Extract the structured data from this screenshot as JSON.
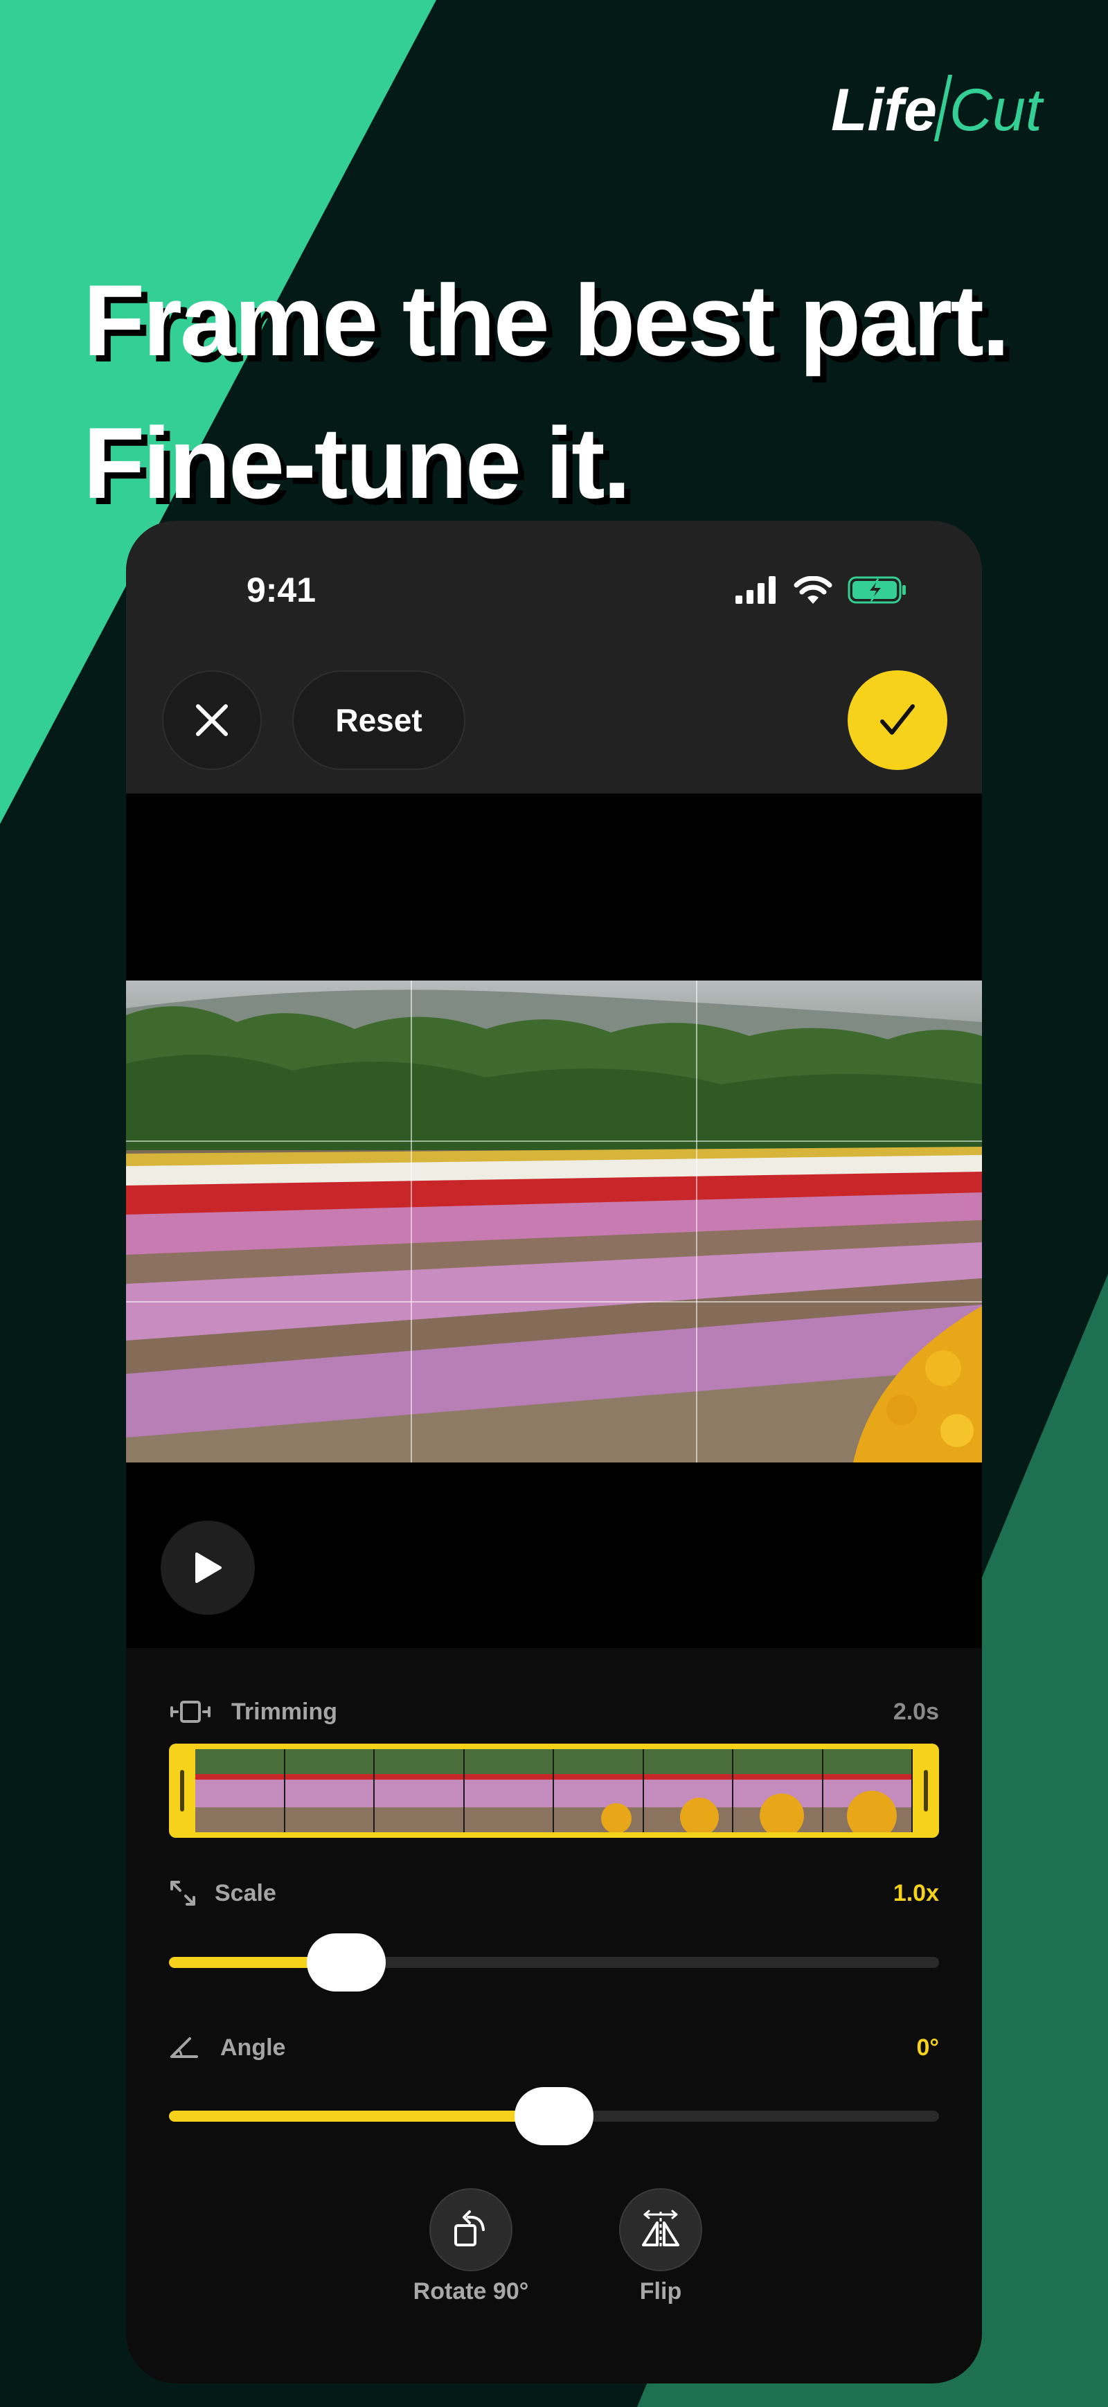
{
  "brand": {
    "logo_left": "Life",
    "logo_right": "Cut"
  },
  "headline": {
    "line1": "Frame the best part.",
    "line2": "Fine-tune it."
  },
  "status_bar": {
    "time": "9:41"
  },
  "toolbar": {
    "reset_label": "Reset"
  },
  "controls": {
    "trimming": {
      "label": "Trimming",
      "value": "2.0s"
    },
    "scale": {
      "label": "Scale",
      "value": "1.0x",
      "level": 0.23
    },
    "angle": {
      "label": "Angle",
      "value": "0°",
      "level": 0.5
    }
  },
  "tools": {
    "rotate_label": "Rotate 90°",
    "flip_label": "Flip"
  },
  "colors": {
    "accent": "#f7d21b",
    "brand_green": "#34cf95",
    "background": "#041a16"
  }
}
